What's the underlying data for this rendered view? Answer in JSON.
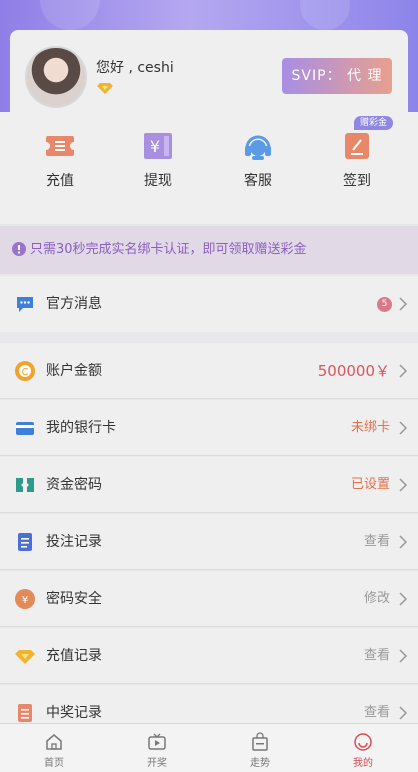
{
  "user": {
    "greeting": "您好 , ceshi",
    "svip_label": "SVIP：  代 理"
  },
  "shortcuts": [
    {
      "label": "充值",
      "icon": "ticket-icon",
      "color": "#e9876b"
    },
    {
      "label": "提现",
      "icon": "yuan-bill-icon",
      "color": "#a98fe0"
    },
    {
      "label": "客服",
      "icon": "headset-icon",
      "color": "#5b9be6"
    },
    {
      "label": "签到",
      "icon": "sign-in-icon",
      "color": "#e9876b"
    }
  ],
  "bonus_tag": "赠彩金",
  "notice": "只需30秒完成实名绑卡认证，即可领取赠送彩金",
  "menu": [
    {
      "label": "官方消息",
      "icon": "message-icon",
      "badge": "5",
      "value": ""
    },
    {
      "label": "账户金额",
      "icon": "coin-icon",
      "value": "500000￥",
      "value_color": "#d9555f"
    },
    {
      "label": "我的银行卡",
      "icon": "bank-card-icon",
      "value": "未绑卡",
      "value_color": "#e5704a"
    },
    {
      "label": "资金密码",
      "icon": "key-icon",
      "value": "已设置",
      "value_color": "#e5704a"
    },
    {
      "label": "投注记录",
      "icon": "document-icon",
      "value": "查看"
    },
    {
      "label": "密码安全",
      "icon": "security-coin-icon",
      "value": "修改"
    },
    {
      "label": "充值记录",
      "icon": "diamond-icon",
      "value": "查看"
    },
    {
      "label": "中奖记录",
      "icon": "list-icon",
      "value": "查看"
    }
  ],
  "tabs": [
    {
      "label": "首页",
      "icon": "home-icon"
    },
    {
      "label": "开奖",
      "icon": "tv-icon"
    },
    {
      "label": "走势",
      "icon": "bag-icon"
    },
    {
      "label": "我的",
      "icon": "profile-icon",
      "active": true
    }
  ],
  "colors": {
    "accent": "#8f7ee6",
    "active_tab": "#d94c55"
  }
}
